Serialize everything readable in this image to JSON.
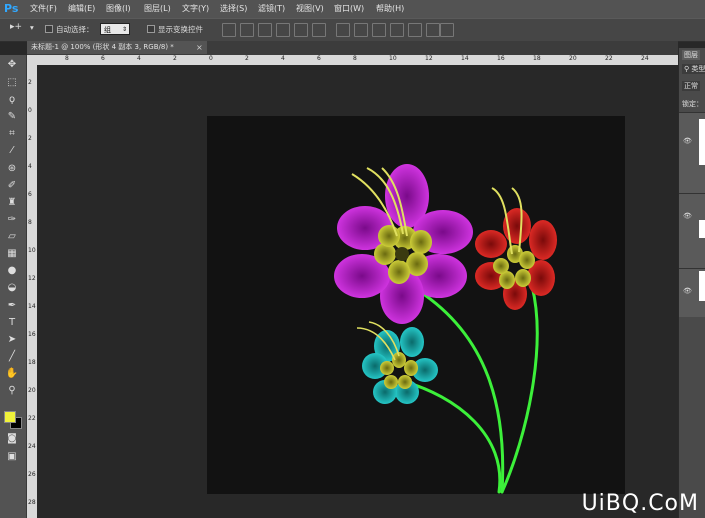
{
  "app": {
    "logo": "Ps"
  },
  "menu": [
    "文件(F)",
    "编辑(E)",
    "图像(I)",
    "图层(L)",
    "文字(Y)",
    "选择(S)",
    "滤镜(T)",
    "视图(V)",
    "窗口(W)",
    "帮助(H)"
  ],
  "options": {
    "auto_select_label": "自动选择：",
    "auto_select_value": "组",
    "show_transform_label": "显示变换控件"
  },
  "document": {
    "tab_title": "未标题-1 @ 100% (形状 4 副本 3, RGB/8) *",
    "close": "×"
  },
  "ruler": {
    "top_ticks": [
      "8",
      "6",
      "4",
      "2",
      "0",
      "2",
      "4",
      "6",
      "8",
      "10",
      "12",
      "14",
      "16",
      "18",
      "20",
      "22",
      "24"
    ],
    "left_ticks": [
      "2",
      "0",
      "2",
      "4",
      "6",
      "8",
      "10",
      "12",
      "14",
      "16",
      "18",
      "20",
      "22",
      "24",
      "26",
      "28"
    ]
  },
  "colors": {
    "foreground": "#f0f23a",
    "background": "#000000"
  },
  "panel": {
    "tab": "图层",
    "kind": "类型",
    "blend": "正常",
    "lock_label": "锁定："
  },
  "watermark": "UiBQ.CoM"
}
